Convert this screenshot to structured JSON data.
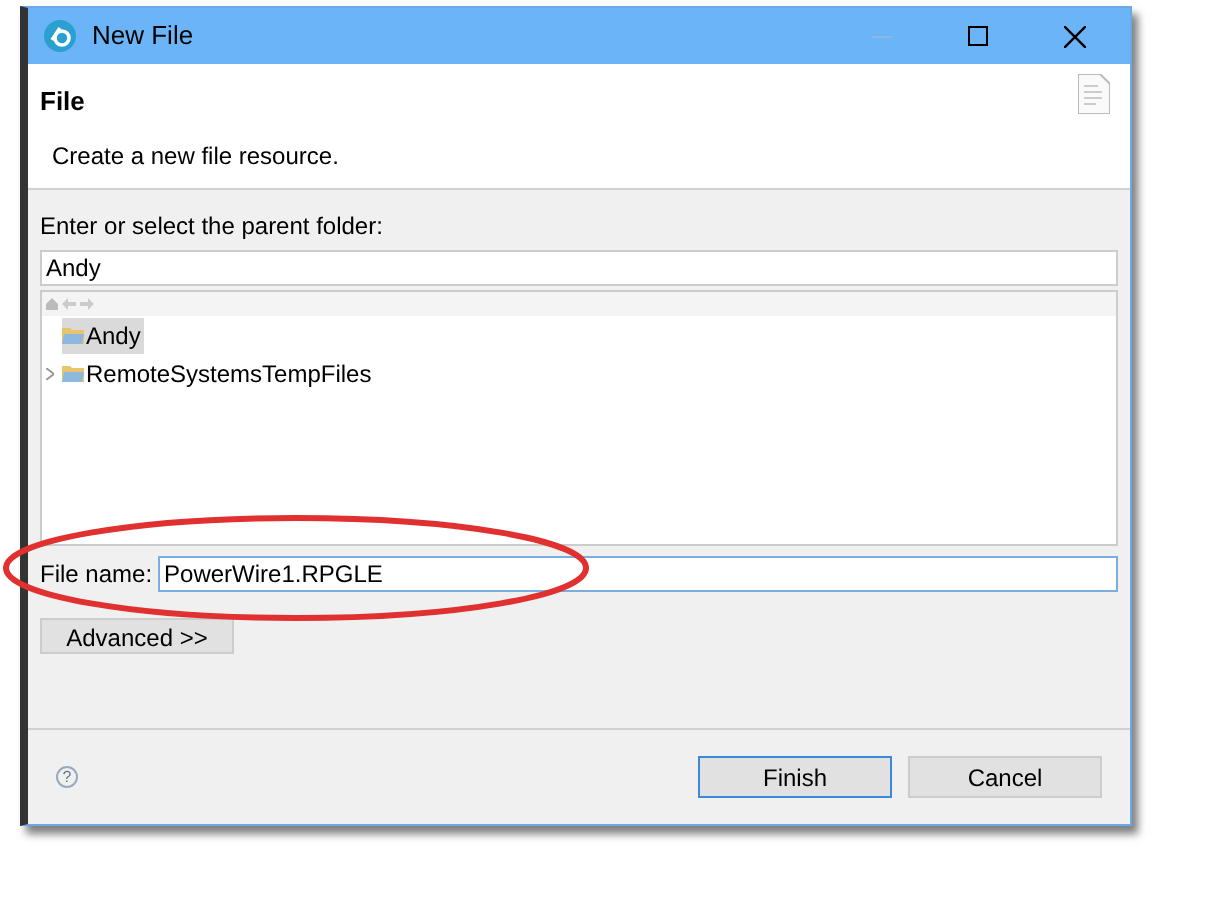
{
  "window": {
    "title": "New File"
  },
  "header": {
    "title": "File",
    "description": "Create a new file resource."
  },
  "parent_folder": {
    "label": "Enter or select the parent folder:",
    "value": "Andy"
  },
  "tree": {
    "items": [
      {
        "label": "Andy",
        "selected": true,
        "expandable": false
      },
      {
        "label": "RemoteSystemsTempFiles",
        "selected": false,
        "expandable": true
      }
    ]
  },
  "file_name": {
    "label": "File name:",
    "value": "PowerWire1.RPGLE"
  },
  "advanced_button": "Advanced >>",
  "help": "?",
  "buttons": [
    {
      "label": "Finish",
      "default": true
    },
    {
      "label": "Cancel",
      "default": false
    }
  ]
}
